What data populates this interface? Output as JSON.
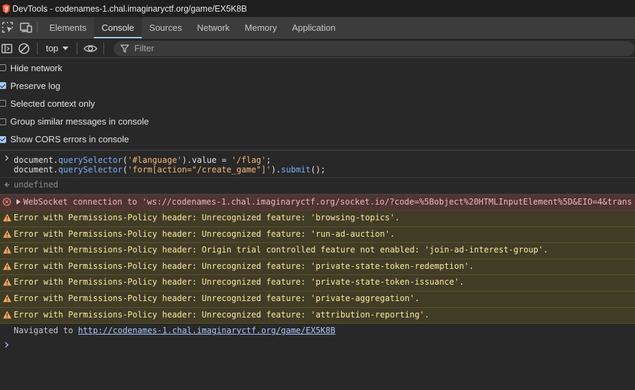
{
  "window": {
    "title": "DevTools - codenames-1.chal.imaginaryctf.org/game/EX5K8B"
  },
  "tabs": [
    {
      "label": "Elements",
      "active": false
    },
    {
      "label": "Console",
      "active": true
    },
    {
      "label": "Sources",
      "active": false
    },
    {
      "label": "Network",
      "active": false
    },
    {
      "label": "Memory",
      "active": false
    },
    {
      "label": "Application",
      "active": false
    }
  ],
  "toolbar": {
    "context": "top",
    "filter_placeholder": "Filter"
  },
  "settings": [
    {
      "label": "Hide network",
      "checked": false
    },
    {
      "label": "Preserve log",
      "checked": true
    },
    {
      "label": "Selected context only",
      "checked": false
    },
    {
      "label": "Group similar messages in console",
      "checked": false
    },
    {
      "label": "Show CORS errors in console",
      "checked": true
    }
  ],
  "console": {
    "input_line1": {
      "obj": "document.",
      "fn": "querySelector",
      "open": "(",
      "arg": "'#language'",
      "rest": ").value = ",
      "val": "'/flag'",
      "end": ";"
    },
    "input_line2": {
      "obj": "document.",
      "fn": "querySelector",
      "open": "(",
      "arg": "'form[action=\"/create_game\"]'",
      "rest": ").",
      "fn2": "submit",
      "end": "();"
    },
    "result": "undefined",
    "error": "WebSocket connection to 'ws://codenames-1.chal.imaginaryctf.org/socket.io/?code=%5Bobject%20HTMLInputElement%5D&EIO=4&trans",
    "warnings": [
      "Error with Permissions-Policy header: Unrecognized feature: 'browsing-topics'.",
      "Error with Permissions-Policy header: Unrecognized feature: 'run-ad-auction'.",
      "Error with Permissions-Policy header: Origin trial controlled feature not enabled: 'join-ad-interest-group'.",
      "Error with Permissions-Policy header: Unrecognized feature: 'private-state-token-redemption'.",
      "Error with Permissions-Policy header: Unrecognized feature: 'private-state-token-issuance'.",
      "Error with Permissions-Policy header: Unrecognized feature: 'private-aggregation'.",
      "Error with Permissions-Policy header: Unrecognized feature: 'attribution-reporting'."
    ],
    "navigated_prefix": "Navigated to ",
    "navigated_url": "http://codenames-1.chal.imaginaryctf.org/game/EX5K8B"
  },
  "colors": {
    "accent": "#a8c7fa",
    "error_bg": "#4e3534",
    "warning_bg": "#413c26",
    "warning_icon": "#f6a55a",
    "error_icon": "#f28b82"
  }
}
